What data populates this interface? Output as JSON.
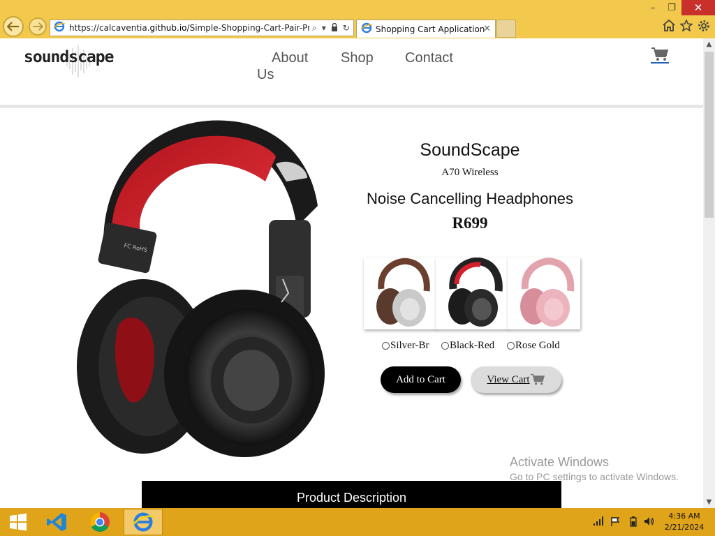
{
  "browser": {
    "url_prefix": "https://calcaventia.",
    "url_domain": "github.io",
    "url_path": "/Simple-Shopping-Cart-Pair-Prjojec",
    "tab_title": "Shopping Cart Application",
    "window_controls": {
      "minimize": "–",
      "restore": "❐",
      "close": "✕"
    }
  },
  "site": {
    "logo_text": "soundscape",
    "nav": {
      "about": "About",
      "us": "Us",
      "shop": "Shop",
      "contact": "Contact"
    }
  },
  "product": {
    "brand": "SoundScape",
    "model": "A70 Wireless",
    "name": "Noise Cancelling Headphones",
    "price": "R699",
    "options": [
      {
        "label": "Silver-Br",
        "color": "#8a5a44"
      },
      {
        "label": "Black-Red",
        "color": "#d3202c"
      },
      {
        "label": "Rose Gold",
        "color": "#e9aab4"
      }
    ],
    "add_to_cart": "Add to Cart",
    "view_cart": "View Cart",
    "description_heading": "Product Description"
  },
  "watermark": {
    "title": "Activate Windows",
    "subtitle": "Go to PC settings to activate Windows."
  },
  "taskbar": {
    "time": "4:36 AM",
    "date": "2/21/2024"
  },
  "colors": {
    "taskbar": "#e0a41a",
    "titlebar": "#f2c94c",
    "accent_red": "#d3202c"
  }
}
